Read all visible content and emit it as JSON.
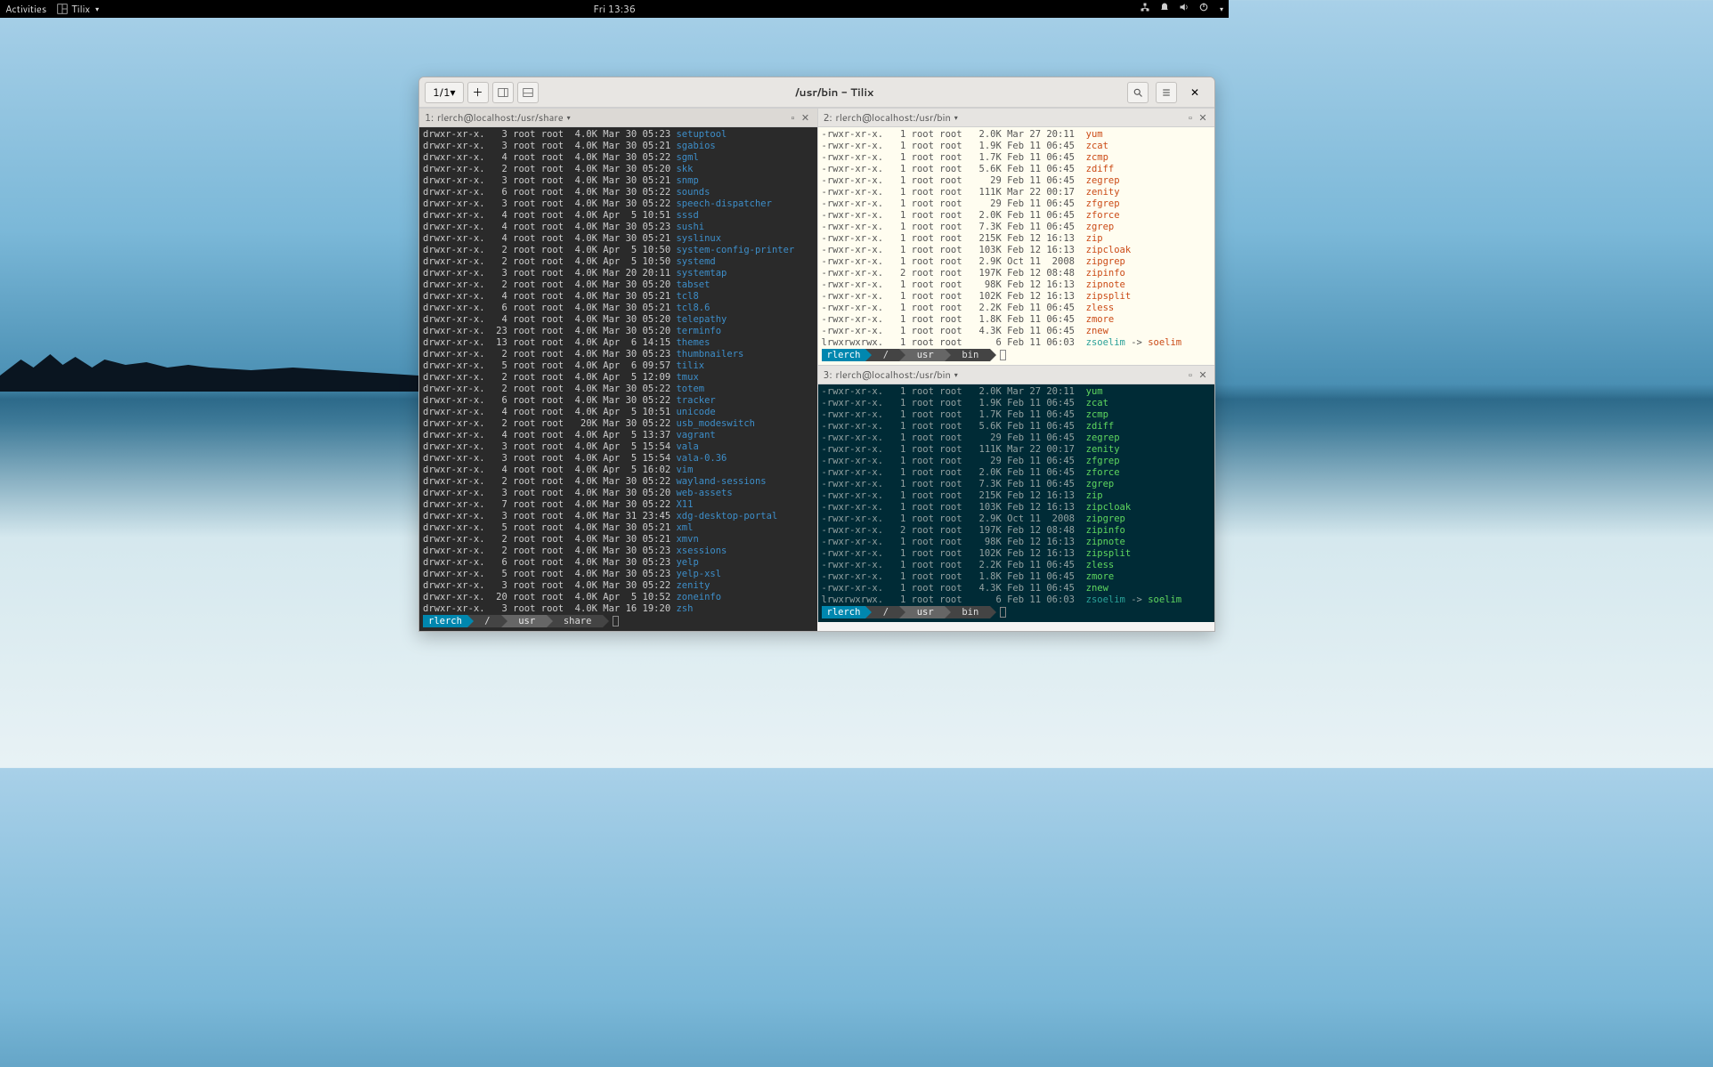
{
  "topbar": {
    "activities": "Activities",
    "app_name": "Tilix",
    "clock": "Fri 13:36"
  },
  "window": {
    "title": "/usr/bin - Tilix",
    "page_indicator": "1/1"
  },
  "panes": {
    "p1": {
      "index": "1:",
      "title": "rlerch@localhost:/usr/share"
    },
    "p2": {
      "index": "2:",
      "title": "rlerch@localhost:/usr/bin"
    },
    "p3": {
      "index": "3:",
      "title": "rlerch@localhost:/usr/bin"
    }
  },
  "prompt": {
    "user": "rlerch",
    "sep": "/",
    "usr": "usr",
    "share": "share",
    "bin": "bin"
  },
  "ls_share": [
    {
      "perm": "drwxr-xr-x.",
      "n": "3",
      "o": "root root",
      "sz": "4.0K",
      "dt": "Mar 30 05:23",
      "name": "setuptool"
    },
    {
      "perm": "drwxr-xr-x.",
      "n": "3",
      "o": "root root",
      "sz": "4.0K",
      "dt": "Mar 30 05:21",
      "name": "sgabios"
    },
    {
      "perm": "drwxr-xr-x.",
      "n": "4",
      "o": "root root",
      "sz": "4.0K",
      "dt": "Mar 30 05:22",
      "name": "sgml"
    },
    {
      "perm": "drwxr-xr-x.",
      "n": "2",
      "o": "root root",
      "sz": "4.0K",
      "dt": "Mar 30 05:20",
      "name": "skk"
    },
    {
      "perm": "drwxr-xr-x.",
      "n": "3",
      "o": "root root",
      "sz": "4.0K",
      "dt": "Mar 30 05:21",
      "name": "snmp"
    },
    {
      "perm": "drwxr-xr-x.",
      "n": "6",
      "o": "root root",
      "sz": "4.0K",
      "dt": "Mar 30 05:22",
      "name": "sounds"
    },
    {
      "perm": "drwxr-xr-x.",
      "n": "3",
      "o": "root root",
      "sz": "4.0K",
      "dt": "Mar 30 05:22",
      "name": "speech-dispatcher"
    },
    {
      "perm": "drwxr-xr-x.",
      "n": "4",
      "o": "root root",
      "sz": "4.0K",
      "dt": "Apr  5 10:51",
      "name": "sssd"
    },
    {
      "perm": "drwxr-xr-x.",
      "n": "4",
      "o": "root root",
      "sz": "4.0K",
      "dt": "Mar 30 05:23",
      "name": "sushi"
    },
    {
      "perm": "drwxr-xr-x.",
      "n": "4",
      "o": "root root",
      "sz": "4.0K",
      "dt": "Mar 30 05:21",
      "name": "syslinux"
    },
    {
      "perm": "drwxr-xr-x.",
      "n": "2",
      "o": "root root",
      "sz": "4.0K",
      "dt": "Apr  5 10:50",
      "name": "system-config-printer"
    },
    {
      "perm": "drwxr-xr-x.",
      "n": "2",
      "o": "root root",
      "sz": "4.0K",
      "dt": "Apr  5 10:50",
      "name": "systemd"
    },
    {
      "perm": "drwxr-xr-x.",
      "n": "3",
      "o": "root root",
      "sz": "4.0K",
      "dt": "Mar 20 20:11",
      "name": "systemtap"
    },
    {
      "perm": "drwxr-xr-x.",
      "n": "2",
      "o": "root root",
      "sz": "4.0K",
      "dt": "Mar 30 05:20",
      "name": "tabset"
    },
    {
      "perm": "drwxr-xr-x.",
      "n": "4",
      "o": "root root",
      "sz": "4.0K",
      "dt": "Mar 30 05:21",
      "name": "tcl8"
    },
    {
      "perm": "drwxr-xr-x.",
      "n": "6",
      "o": "root root",
      "sz": "4.0K",
      "dt": "Mar 30 05:21",
      "name": "tcl8.6"
    },
    {
      "perm": "drwxr-xr-x.",
      "n": "4",
      "o": "root root",
      "sz": "4.0K",
      "dt": "Mar 30 05:20",
      "name": "telepathy"
    },
    {
      "perm": "drwxr-xr-x.",
      "n": "23",
      "o": "root root",
      "sz": "4.0K",
      "dt": "Mar 30 05:20",
      "name": "terminfo"
    },
    {
      "perm": "drwxr-xr-x.",
      "n": "13",
      "o": "root root",
      "sz": "4.0K",
      "dt": "Apr  6 14:15",
      "name": "themes"
    },
    {
      "perm": "drwxr-xr-x.",
      "n": "2",
      "o": "root root",
      "sz": "4.0K",
      "dt": "Mar 30 05:23",
      "name": "thumbnailers"
    },
    {
      "perm": "drwxr-xr-x.",
      "n": "5",
      "o": "root root",
      "sz": "4.0K",
      "dt": "Apr  6 09:57",
      "name": "tilix"
    },
    {
      "perm": "drwxr-xr-x.",
      "n": "2",
      "o": "root root",
      "sz": "4.0K",
      "dt": "Apr  5 12:09",
      "name": "tmux"
    },
    {
      "perm": "drwxr-xr-x.",
      "n": "2",
      "o": "root root",
      "sz": "4.0K",
      "dt": "Mar 30 05:22",
      "name": "totem"
    },
    {
      "perm": "drwxr-xr-x.",
      "n": "6",
      "o": "root root",
      "sz": "4.0K",
      "dt": "Mar 30 05:22",
      "name": "tracker"
    },
    {
      "perm": "drwxr-xr-x.",
      "n": "4",
      "o": "root root",
      "sz": "4.0K",
      "dt": "Apr  5 10:51",
      "name": "unicode"
    },
    {
      "perm": "drwxr-xr-x.",
      "n": "2",
      "o": "root root",
      "sz": " 20K",
      "dt": "Mar 30 05:22",
      "name": "usb_modeswitch"
    },
    {
      "perm": "drwxr-xr-x.",
      "n": "4",
      "o": "root root",
      "sz": "4.0K",
      "dt": "Apr  5 13:37",
      "name": "vagrant"
    },
    {
      "perm": "drwxr-xr-x.",
      "n": "3",
      "o": "root root",
      "sz": "4.0K",
      "dt": "Apr  5 15:54",
      "name": "vala"
    },
    {
      "perm": "drwxr-xr-x.",
      "n": "3",
      "o": "root root",
      "sz": "4.0K",
      "dt": "Apr  5 15:54",
      "name": "vala-0.36"
    },
    {
      "perm": "drwxr-xr-x.",
      "n": "4",
      "o": "root root",
      "sz": "4.0K",
      "dt": "Apr  5 16:02",
      "name": "vim"
    },
    {
      "perm": "drwxr-xr-x.",
      "n": "2",
      "o": "root root",
      "sz": "4.0K",
      "dt": "Mar 30 05:22",
      "name": "wayland-sessions"
    },
    {
      "perm": "drwxr-xr-x.",
      "n": "3",
      "o": "root root",
      "sz": "4.0K",
      "dt": "Mar 30 05:20",
      "name": "web-assets"
    },
    {
      "perm": "drwxr-xr-x.",
      "n": "7",
      "o": "root root",
      "sz": "4.0K",
      "dt": "Mar 30 05:22",
      "name": "X11"
    },
    {
      "perm": "drwxr-xr-x.",
      "n": "3",
      "o": "root root",
      "sz": "4.0K",
      "dt": "Mar 31 23:45",
      "name": "xdg-desktop-portal"
    },
    {
      "perm": "drwxr-xr-x.",
      "n": "5",
      "o": "root root",
      "sz": "4.0K",
      "dt": "Mar 30 05:21",
      "name": "xml"
    },
    {
      "perm": "drwxr-xr-x.",
      "n": "2",
      "o": "root root",
      "sz": "4.0K",
      "dt": "Mar 30 05:21",
      "name": "xmvn"
    },
    {
      "perm": "drwxr-xr-x.",
      "n": "2",
      "o": "root root",
      "sz": "4.0K",
      "dt": "Mar 30 05:23",
      "name": "xsessions"
    },
    {
      "perm": "drwxr-xr-x.",
      "n": "6",
      "o": "root root",
      "sz": "4.0K",
      "dt": "Mar 30 05:23",
      "name": "yelp"
    },
    {
      "perm": "drwxr-xr-x.",
      "n": "5",
      "o": "root root",
      "sz": "4.0K",
      "dt": "Mar 30 05:23",
      "name": "yelp-xsl"
    },
    {
      "perm": "drwxr-xr-x.",
      "n": "3",
      "o": "root root",
      "sz": "4.0K",
      "dt": "Mar 30 05:22",
      "name": "zenity"
    },
    {
      "perm": "drwxr-xr-x.",
      "n": "20",
      "o": "root root",
      "sz": "4.0K",
      "dt": "Apr  5 10:52",
      "name": "zoneinfo"
    },
    {
      "perm": "drwxr-xr-x.",
      "n": "3",
      "o": "root root",
      "sz": "4.0K",
      "dt": "Mar 16 19:20",
      "name": "zsh"
    }
  ],
  "ls_bin": [
    {
      "perm": "-rwxr-xr-x.",
      "n": "1",
      "o": "root root",
      "sz": "2.0K",
      "dt": "Mar 27 20:11",
      "name": "yum",
      "c": "g"
    },
    {
      "perm": "-rwxr-xr-x.",
      "n": "1",
      "o": "root root",
      "sz": "1.9K",
      "dt": "Feb 11 06:45",
      "name": "zcat",
      "c": "g"
    },
    {
      "perm": "-rwxr-xr-x.",
      "n": "1",
      "o": "root root",
      "sz": "1.7K",
      "dt": "Feb 11 06:45",
      "name": "zcmp",
      "c": "g"
    },
    {
      "perm": "-rwxr-xr-x.",
      "n": "1",
      "o": "root root",
      "sz": "5.6K",
      "dt": "Feb 11 06:45",
      "name": "zdiff",
      "c": "g"
    },
    {
      "perm": "-rwxr-xr-x.",
      "n": "1",
      "o": "root root",
      "sz": "  29",
      "dt": "Feb 11 06:45",
      "name": "zegrep",
      "c": "g"
    },
    {
      "perm": "-rwxr-xr-x.",
      "n": "1",
      "o": "root root",
      "sz": "111K",
      "dt": "Mar 22 00:17",
      "name": "zenity",
      "c": "g"
    },
    {
      "perm": "-rwxr-xr-x.",
      "n": "1",
      "o": "root root",
      "sz": "  29",
      "dt": "Feb 11 06:45",
      "name": "zfgrep",
      "c": "g"
    },
    {
      "perm": "-rwxr-xr-x.",
      "n": "1",
      "o": "root root",
      "sz": "2.0K",
      "dt": "Feb 11 06:45",
      "name": "zforce",
      "c": "g"
    },
    {
      "perm": "-rwxr-xr-x.",
      "n": "1",
      "o": "root root",
      "sz": "7.3K",
      "dt": "Feb 11 06:45",
      "name": "zgrep",
      "c": "g"
    },
    {
      "perm": "-rwxr-xr-x.",
      "n": "1",
      "o": "root root",
      "sz": "215K",
      "dt": "Feb 12 16:13",
      "name": "zip",
      "c": "g"
    },
    {
      "perm": "-rwxr-xr-x.",
      "n": "1",
      "o": "root root",
      "sz": "103K",
      "dt": "Feb 12 16:13",
      "name": "zipcloak",
      "c": "g"
    },
    {
      "perm": "-rwxr-xr-x.",
      "n": "1",
      "o": "root root",
      "sz": "2.9K",
      "dt": "Oct 11  2008",
      "name": "zipgrep",
      "c": "g"
    },
    {
      "perm": "-rwxr-xr-x.",
      "n": "2",
      "o": "root root",
      "sz": "197K",
      "dt": "Feb 12 08:48",
      "name": "zipinfo",
      "c": "g"
    },
    {
      "perm": "-rwxr-xr-x.",
      "n": "1",
      "o": "root root",
      "sz": " 98K",
      "dt": "Feb 12 16:13",
      "name": "zipnote",
      "c": "g"
    },
    {
      "perm": "-rwxr-xr-x.",
      "n": "1",
      "o": "root root",
      "sz": "102K",
      "dt": "Feb 12 16:13",
      "name": "zipsplit",
      "c": "g"
    },
    {
      "perm": "-rwxr-xr-x.",
      "n": "1",
      "o": "root root",
      "sz": "2.2K",
      "dt": "Feb 11 06:45",
      "name": "zless",
      "c": "g"
    },
    {
      "perm": "-rwxr-xr-x.",
      "n": "1",
      "o": "root root",
      "sz": "1.8K",
      "dt": "Feb 11 06:45",
      "name": "zmore",
      "c": "g"
    },
    {
      "perm": "-rwxr-xr-x.",
      "n": "1",
      "o": "root root",
      "sz": "4.3K",
      "dt": "Feb 11 06:45",
      "name": "znew",
      "c": "g"
    },
    {
      "perm": "lrwxrwxrwx.",
      "n": "1",
      "o": "root root",
      "sz": "   6",
      "dt": "Feb 11 06:03",
      "name": "zsoelim",
      "c": "l",
      "target": "soelim"
    }
  ],
  "link_arrow": " -> "
}
